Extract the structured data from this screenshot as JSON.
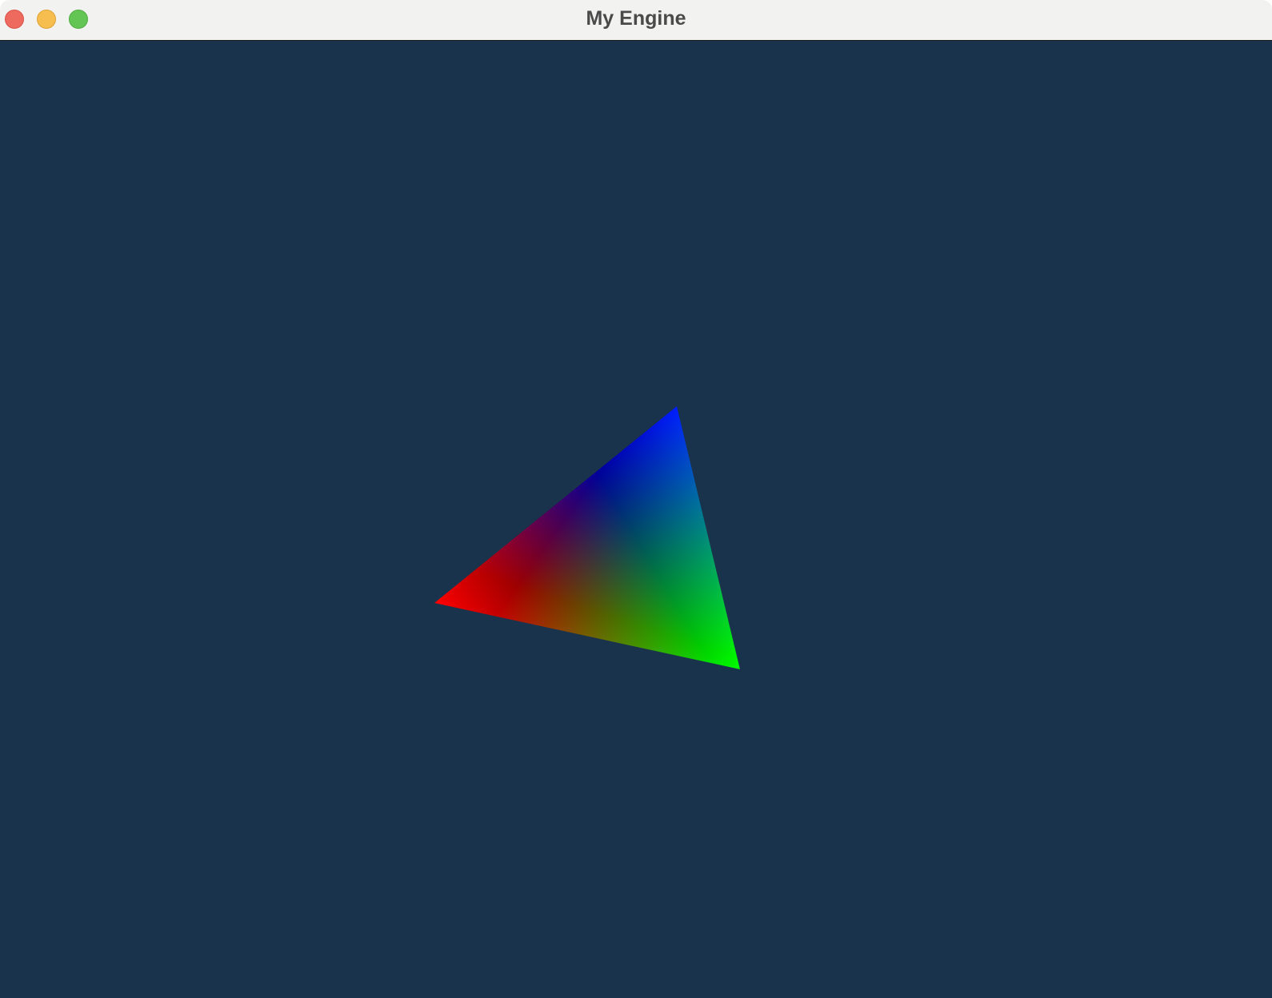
{
  "window": {
    "title": "My Engine",
    "controls": {
      "close_color": "#ee6a5f",
      "minimize_color": "#f5be4f",
      "zoom_color": "#62c554"
    }
  },
  "viewport": {
    "clear_color": "#1a334c",
    "triangle": {
      "vertex_colors": {
        "left": "#ff0000",
        "top": "#0000ff",
        "right": "#00ff00"
      }
    }
  }
}
